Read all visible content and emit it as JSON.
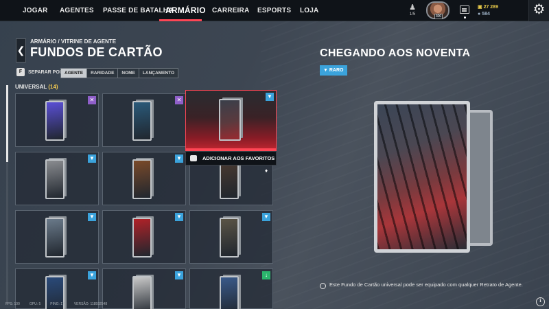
{
  "nav": {
    "items": [
      "JOGAR",
      "AGENTES",
      "PASSE DE BATALHA",
      "ARMÁRIO",
      "CARREIRA",
      "ESPORTS",
      "LOJA"
    ],
    "friends_count": "1/5",
    "avatar_level": "300",
    "radianite_points": "27 289",
    "valorant_points": "584",
    "settings_icon": "gear-icon"
  },
  "header": {
    "breadcrumb": "ARMÁRIO / VITRINE DE AGENTE",
    "title": "FUNDOS DE CARTÃO",
    "back_icon": "chevron-left-icon"
  },
  "sort": {
    "key": "F",
    "label": "SEPARAR POR",
    "options": [
      "AGENTE",
      "RARIDADE",
      "NOME",
      "LANÇAMENTO"
    ],
    "selected": "AGENTE"
  },
  "section": {
    "label": "UNIVERSAL",
    "count": "(14)"
  },
  "grid": {
    "cells": [
      {
        "badge": "cross",
        "art": "#5a4fd6"
      },
      {
        "badge": "cross",
        "art": "#2a5a7a"
      },
      {
        "badge": "filter",
        "art": "#8a8c90"
      },
      {
        "badge": "filter",
        "art": "#7a4a2a"
      },
      {
        "badge": "none",
        "art": "#4a3a30"
      },
      {
        "badge": "filter",
        "art": "#6a7a8a"
      },
      {
        "badge": "filter",
        "art": "#b02228"
      },
      {
        "badge": "filter",
        "art": "#5a5446"
      },
      {
        "badge": "filter",
        "art": "#2a4a7a"
      },
      {
        "badge": "filter",
        "art": "#c8c8c8"
      },
      {
        "badge": "green",
        "art": "#3a5a8a"
      }
    ]
  },
  "hover": {
    "favorite_key": "key-icon",
    "favorite_label": "ADICIONAR AOS FAVORITOS"
  },
  "detail": {
    "title": "CHEGANDO AOS NOVENTA",
    "rarity": "RARO",
    "info": "Este Fundo de Cartão universal pode ser equipado com qualquer Retrato de Agente."
  },
  "footer": {
    "fps": "FPS: 100",
    "gpu": "GPU: 5",
    "ping": "PING: 17",
    "version": "VERSÃO: 118592548"
  }
}
